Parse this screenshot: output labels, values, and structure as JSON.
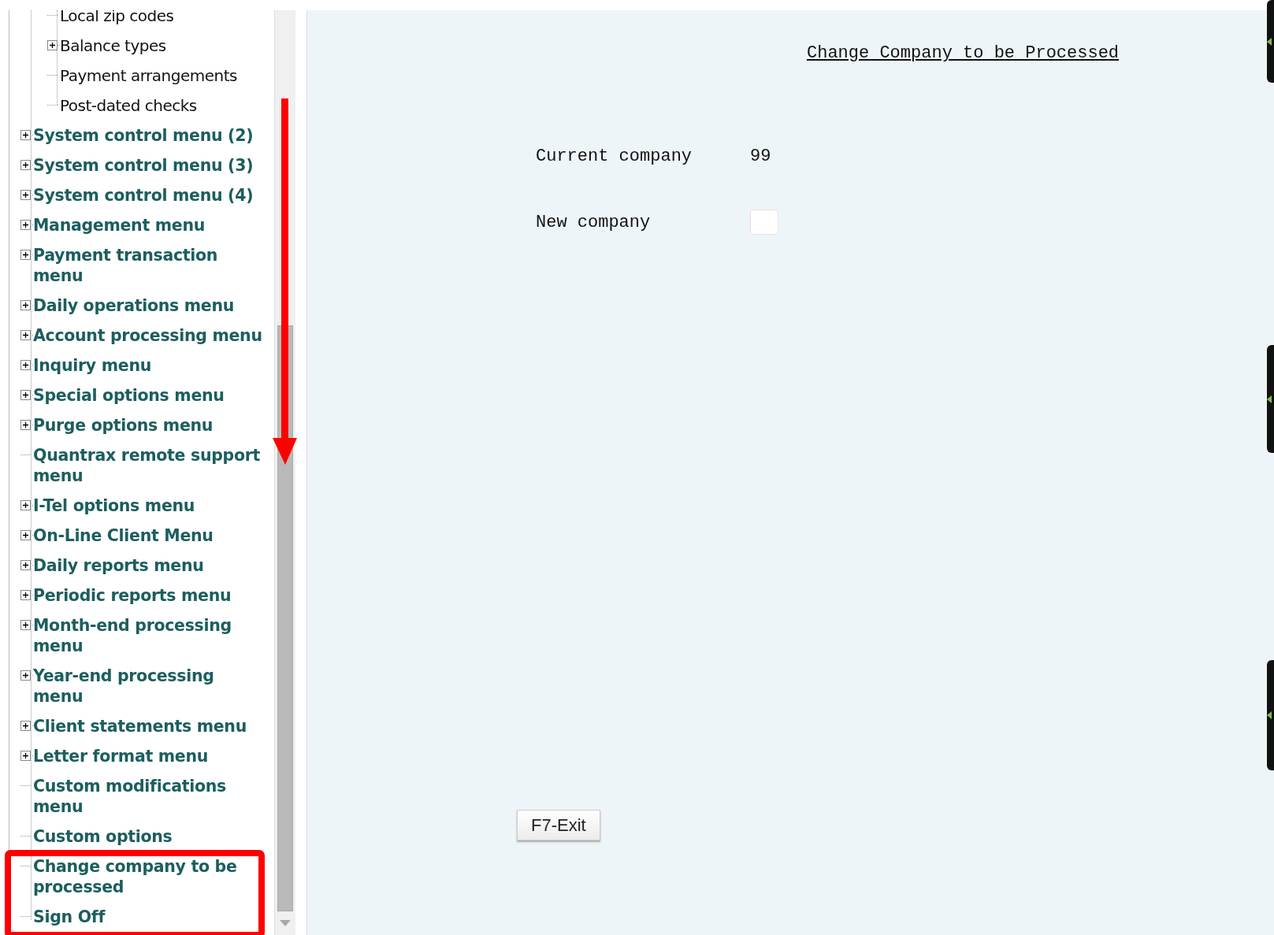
{
  "tree": {
    "nested_items": [
      {
        "label": "Local zip codes",
        "kind": "leaf"
      },
      {
        "label": "Balance types",
        "kind": "folder"
      },
      {
        "label": "Payment arrangements",
        "kind": "leaf"
      },
      {
        "label": "Post-dated checks",
        "kind": "leaf"
      }
    ],
    "items": [
      {
        "label": "System control menu (2)",
        "kind": "folder"
      },
      {
        "label": "System control menu (3)",
        "kind": "folder"
      },
      {
        "label": "System control menu (4)",
        "kind": "folder"
      },
      {
        "label": "Management menu",
        "kind": "folder"
      },
      {
        "label": "Payment transaction menu",
        "kind": "folder"
      },
      {
        "label": "Daily operations menu",
        "kind": "folder"
      },
      {
        "label": "Account processing menu",
        "kind": "folder"
      },
      {
        "label": "Inquiry menu",
        "kind": "folder"
      },
      {
        "label": "Special options menu",
        "kind": "folder"
      },
      {
        "label": "Purge options menu",
        "kind": "folder"
      },
      {
        "label": "Quantrax remote support menu",
        "kind": "leaf"
      },
      {
        "label": "I-Tel options menu",
        "kind": "folder"
      },
      {
        "label": "On-Line Client Menu",
        "kind": "folder"
      },
      {
        "label": "Daily reports menu",
        "kind": "folder"
      },
      {
        "label": "Periodic reports menu",
        "kind": "folder"
      },
      {
        "label": "Month-end processing menu",
        "kind": "folder"
      },
      {
        "label": "Year-end processing menu",
        "kind": "folder"
      },
      {
        "label": "Client statements menu",
        "kind": "folder"
      },
      {
        "label": "Letter format menu",
        "kind": "folder"
      },
      {
        "label": "Custom modifications menu",
        "kind": "leaf"
      },
      {
        "label": "Custom options",
        "kind": "leaf"
      },
      {
        "label": "Change company to be processed",
        "kind": "leaf"
      },
      {
        "label": "Sign Off",
        "kind": "leaf"
      }
    ]
  },
  "form": {
    "title": "Change Company to be Processed",
    "fields": [
      {
        "label": "Current company",
        "value": "99",
        "kind": "display"
      },
      {
        "label": "New company",
        "kind": "input"
      }
    ],
    "buttons": [
      "F7-Exit"
    ]
  }
}
